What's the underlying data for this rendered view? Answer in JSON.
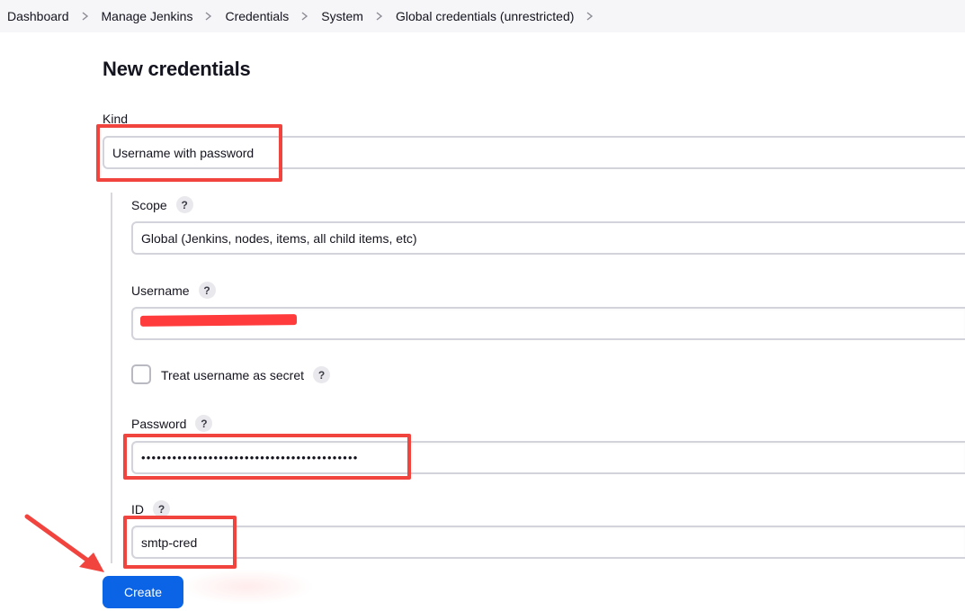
{
  "breadcrumb": {
    "items": [
      {
        "label": "Dashboard"
      },
      {
        "label": "Manage Jenkins"
      },
      {
        "label": "Credentials"
      },
      {
        "label": "System"
      },
      {
        "label": "Global credentials (unrestricted)"
      }
    ]
  },
  "page": {
    "title": "New credentials"
  },
  "form": {
    "kind": {
      "label": "Kind",
      "value": "Username with password"
    },
    "scope": {
      "label": "Scope",
      "help": "?",
      "value": "Global (Jenkins, nodes, items, all child items, etc)"
    },
    "username": {
      "label": "Username",
      "help": "?"
    },
    "treat_secret": {
      "label": "Treat username as secret",
      "help": "?",
      "checked": false
    },
    "password": {
      "label": "Password",
      "help": "?",
      "value": "••••••••••••••••••••••••••••••••••••••••••"
    },
    "id": {
      "label": "ID",
      "help": "?",
      "value": "smtp-cred"
    },
    "create_label": "Create"
  },
  "annotations": {
    "highlight_color": "#f2443e",
    "arrow_color": "#f2443e"
  },
  "colors": {
    "primary_button": "#0b63e5",
    "redaction": "#ff3b3b"
  }
}
